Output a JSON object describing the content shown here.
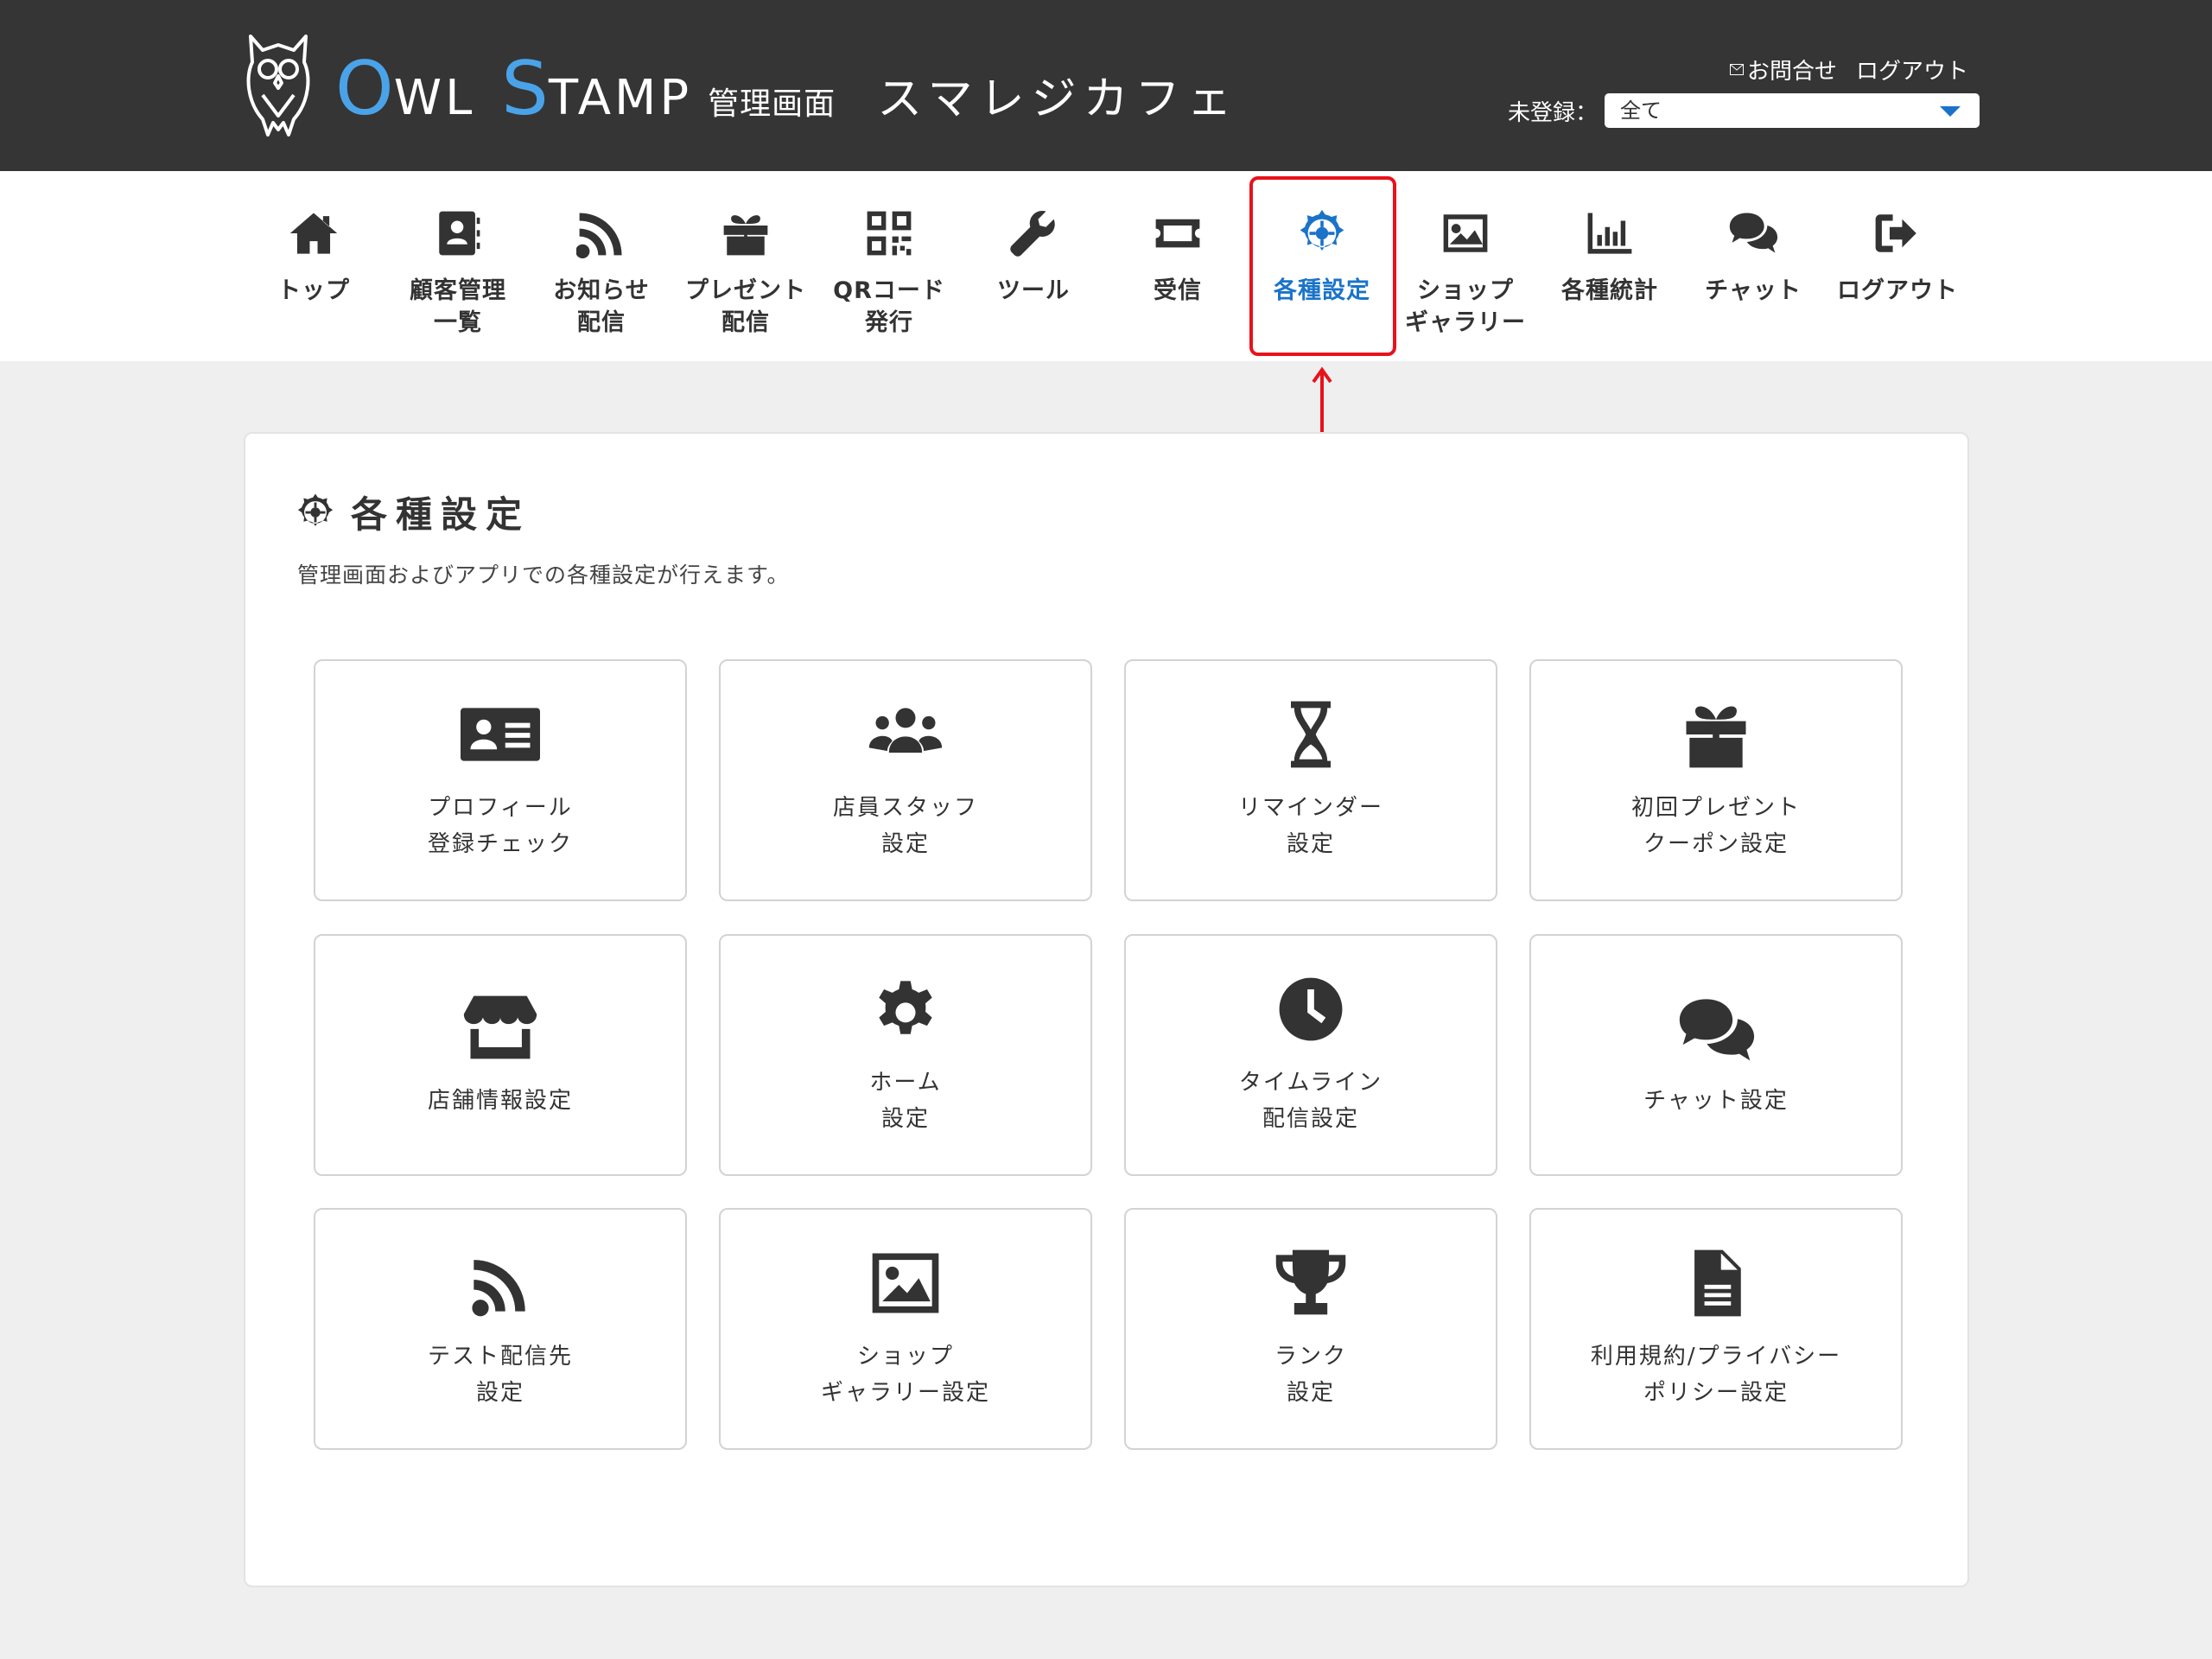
{
  "header": {
    "brand_o": "O",
    "brand_wl": "WL",
    "brand_s": "S",
    "brand_tamp": "TAMP",
    "brand_sub": "管理画面",
    "shop_name": "スマレジカフェ",
    "contact_label": "お問合せ",
    "logout_label": "ログアウト",
    "store_filter_label": "未登録：",
    "store_filter_value": "全て"
  },
  "nav": {
    "items": [
      {
        "label": "トップ",
        "icon": "home-icon"
      },
      {
        "label": "顧客管理\n一覧",
        "icon": "address-book-icon"
      },
      {
        "label": "お知らせ\n配信",
        "icon": "rss-icon"
      },
      {
        "label": "プレゼント\n配信",
        "icon": "gift-icon"
      },
      {
        "label": "QRコード\n発行",
        "icon": "qrcode-icon"
      },
      {
        "label": "ツール",
        "icon": "wrench-icon"
      },
      {
        "label": "受信",
        "icon": "ticket-icon"
      },
      {
        "label": "各種設定",
        "icon": "helm-icon"
      },
      {
        "label": "ショップ\nギャラリー",
        "icon": "image-icon"
      },
      {
        "label": "各種統計",
        "icon": "chart-icon"
      },
      {
        "label": "チャット",
        "icon": "comments-icon"
      },
      {
        "label": "ログアウト",
        "icon": "sign-out-icon"
      }
    ],
    "active_index": 7
  },
  "main": {
    "title": "各種設定",
    "description": "管理画面およびアプリでの各種設定が行えます。",
    "cards": [
      {
        "label": "プロフィール\n登録チェック",
        "icon": "id-card-icon"
      },
      {
        "label": "店員スタッフ\n設定",
        "icon": "users-icon"
      },
      {
        "label": "リマインダー\n設定",
        "icon": "hourglass-icon"
      },
      {
        "label": "初回プレゼント\nクーポン設定",
        "icon": "gift-icon"
      },
      {
        "label": "店舗情報設定",
        "icon": "store-icon"
      },
      {
        "label": "ホーム\n設定",
        "icon": "gear-icon"
      },
      {
        "label": "タイムライン\n配信設定",
        "icon": "clock-icon"
      },
      {
        "label": "チャット設定",
        "icon": "comments-icon"
      },
      {
        "label": "テスト配信先\n設定",
        "icon": "rss-icon"
      },
      {
        "label": "ショップ\nギャラリー設定",
        "icon": "image-icon"
      },
      {
        "label": "ランク\n設定",
        "icon": "trophy-icon"
      },
      {
        "label": "利用規約/プライバシー\nポリシー設定",
        "icon": "document-icon"
      }
    ]
  },
  "colors": {
    "header_bg": "#353535",
    "brand_accent": "#4aa3e8",
    "active_blue": "#1a73c9",
    "highlight_red": "#e8121b",
    "page_bg": "#efefef"
  }
}
